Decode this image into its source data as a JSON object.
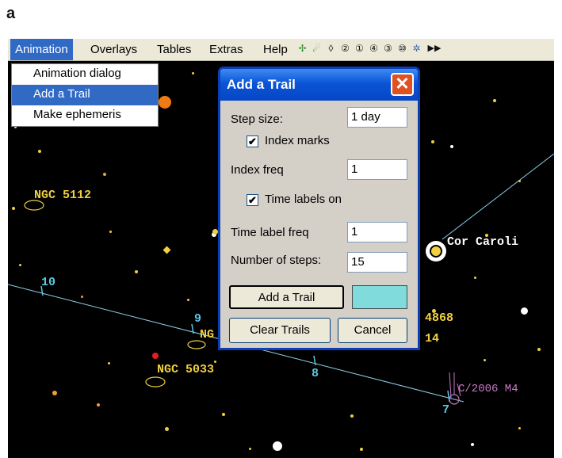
{
  "figure_label": "a",
  "menu": {
    "items": [
      "Animation",
      "Overlays",
      "Tables",
      "Extras",
      "Help"
    ],
    "active": "Animation"
  },
  "toolbar": {
    "icons": [
      "satellite-icon",
      "comet-icon",
      "zoom-reset-icon",
      "zoom-2-icon",
      "zoom-1-icon",
      "zoom-4-icon",
      "zoom-3-icon",
      "zoom-magnify-icon",
      "stars-icon",
      "fast-forward-icon"
    ],
    "glyphs": [
      "✢",
      "☄",
      "◊",
      "②",
      "①",
      "④",
      "③",
      "⑩",
      "✲",
      "▶▶"
    ]
  },
  "dropdown": {
    "items": [
      "Animation dialog",
      "Add a Trail",
      "Make ephemeris"
    ],
    "selected": "Add a Trail"
  },
  "dialog": {
    "title": "Add a Trail",
    "close_glyph": "✕",
    "step_size_label": "Step size:",
    "step_size_value": "1 day",
    "index_marks_label": "Index marks",
    "index_marks_checked": true,
    "index_freq_label": "Index freq",
    "index_freq_value": "1",
    "time_labels_label": "Time labels on",
    "time_labels_checked": true,
    "time_label_freq_label": "Time label freq",
    "time_label_freq_value": "1",
    "num_steps_label": "Number of steps:",
    "num_steps_value": "15",
    "add_button": "Add a Trail",
    "clear_button": "Clear Trails",
    "cancel_button": "Cancel",
    "trail_color": "#80dcdc",
    "check_glyph": "✔"
  },
  "sky": {
    "labels": {
      "ngc5112": "NGC 5112",
      "cor_caroli": "Cor Caroli",
      "ngc5033": "NGC 5033",
      "ngc_partial": "NG",
      "ngc4868": "4868",
      "partial_14": "14",
      "comet": "C/2006 M4",
      "mark10": "10",
      "mark9": "9",
      "mark8": "8",
      "mark7": "7"
    },
    "colors": {
      "background": "#000000",
      "galaxy_label": "#f0d040",
      "star_label": "#ffffff",
      "trail_mark": "#5bc8e0",
      "comet": "#c878c8",
      "trail_line": "#8ad0e8"
    }
  }
}
